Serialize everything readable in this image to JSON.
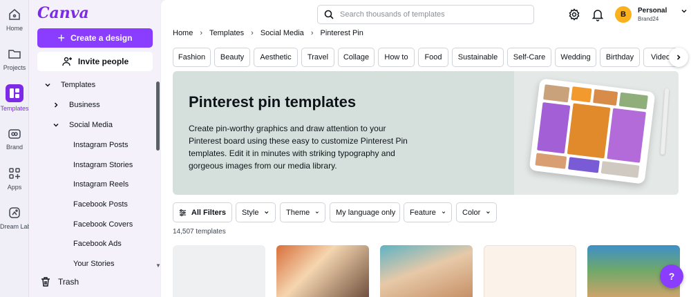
{
  "rail": {
    "items": [
      {
        "label": "Home",
        "icon": "home-icon"
      },
      {
        "label": "Projects",
        "icon": "folder-icon"
      },
      {
        "label": "Templates",
        "icon": "templates-icon",
        "active": true
      },
      {
        "label": "Brand",
        "icon": "brand-icon"
      },
      {
        "label": "Apps",
        "icon": "apps-icon"
      },
      {
        "label": "Dream Lab",
        "icon": "dream-lab-icon"
      }
    ]
  },
  "panel": {
    "logo": "Canva",
    "create_label": "Create a design",
    "invite_label": "Invite people",
    "tree": [
      {
        "label": "Templates",
        "expanded": true
      },
      {
        "label": "Business",
        "expanded": false
      },
      {
        "label": "Social Media",
        "expanded": true
      },
      {
        "label": "Instagram Posts"
      },
      {
        "label": "Instagram Stories"
      },
      {
        "label": "Instagram Reels"
      },
      {
        "label": "Facebook Posts"
      },
      {
        "label": "Facebook Covers"
      },
      {
        "label": "Facebook Ads"
      },
      {
        "label": "Your Stories"
      }
    ],
    "trash_label": "Trash"
  },
  "header": {
    "search_placeholder": "Search thousands of templates",
    "account_name": "Personal",
    "account_sub": "Brand24",
    "avatar_initial": "B"
  },
  "breadcrumbs": [
    "Home",
    "Templates",
    "Social Media",
    "Pinterest Pin"
  ],
  "categories": [
    "Fashion",
    "Beauty",
    "Aesthetic",
    "Travel",
    "Collage",
    "How to",
    "Food",
    "Sustainable",
    "Self-Care",
    "Wedding",
    "Birthday",
    "Video"
  ],
  "hero": {
    "title": "Pinterest pin templates",
    "description": "Create pin-worthy graphics and draw attention to your Pinterest board using these easy to customize Pinterest Pin templates. Edit it in minutes with striking typography and gorgeous images from our media library."
  },
  "filters": [
    "All Filters",
    "Style",
    "Theme",
    "My language only",
    "Feature",
    "Color"
  ],
  "result_count": "14,507 templates",
  "help_label": "?",
  "colors": {
    "accent": "#8b3dff",
    "hero_bg": "#d5e0dc"
  }
}
